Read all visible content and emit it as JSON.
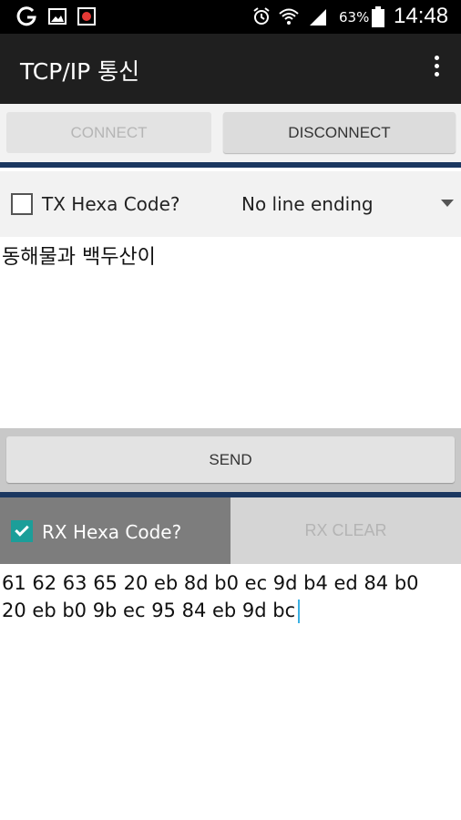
{
  "status_bar": {
    "battery_percent": "63%",
    "time": "14:48",
    "icons": [
      "g-icon",
      "image-icon",
      "record-icon",
      "alarm-icon",
      "wifi-icon",
      "signal-icon",
      "battery-icon"
    ]
  },
  "app": {
    "title": "TCP/IP 통신",
    "menu_icon": "overflow-menu-icon"
  },
  "connection": {
    "connect_label": "CONNECT",
    "disconnect_label": "DISCONNECT",
    "connect_enabled": false
  },
  "tx": {
    "hex_label": "TX Hexa Code?",
    "hex_checked": false,
    "line_ending": "No line ending",
    "text": "동해물과 백두산이",
    "send_label": "SEND"
  },
  "rx": {
    "hex_label": "RX Hexa Code?",
    "hex_checked": true,
    "clear_label": "RX CLEAR",
    "lines": [
      "61 62 63 65 20 eb 8d b0 ec 9d b4 ed 84 b0",
      "20 eb b0 9b ec 95 84 eb 9d bc"
    ]
  },
  "colors": {
    "divider": "#1b3760",
    "accent": "#1c9e99",
    "action_bar": "#1f1f1f"
  }
}
